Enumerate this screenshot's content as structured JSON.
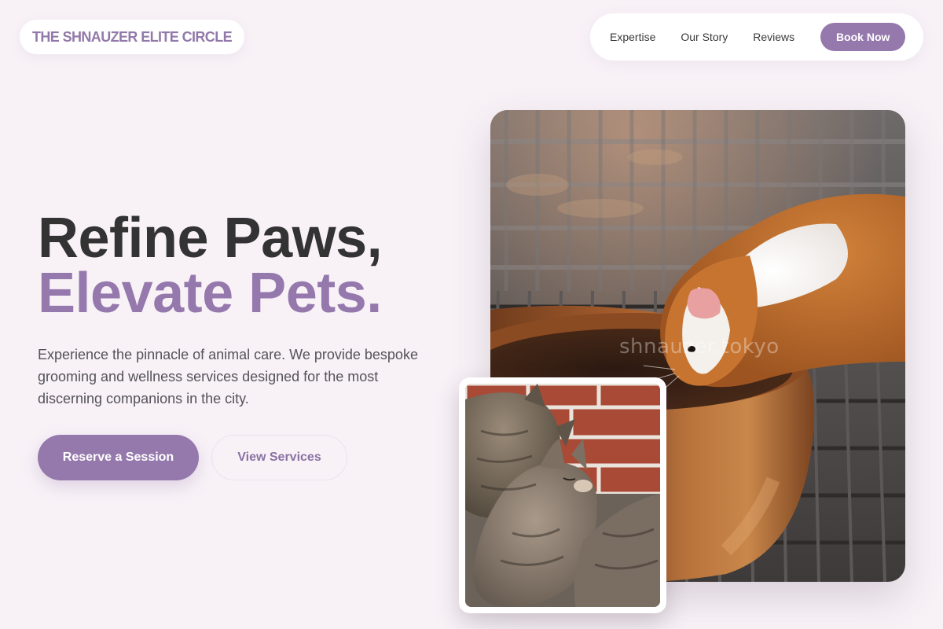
{
  "header": {
    "logo": "THE SHNAUZER ELITE CIRCLE",
    "nav": [
      "Expertise",
      "Our Story",
      "Reviews"
    ],
    "cta": "Book Now"
  },
  "hero": {
    "title_line1": "Refine Paws,",
    "title_line2": "Elevate Pets.",
    "description": "Experience the pinnacle of animal care. We provide bespoke grooming and wellness services designed for the most discerning companions in the city.",
    "primary_button": "Reserve a Session",
    "secondary_button": "View Services"
  },
  "images": {
    "main_watermark": "shnauzer.tokyo"
  },
  "colors": {
    "accent": "#9579ad",
    "background": "#f8f2f7",
    "heading": "#333333"
  }
}
